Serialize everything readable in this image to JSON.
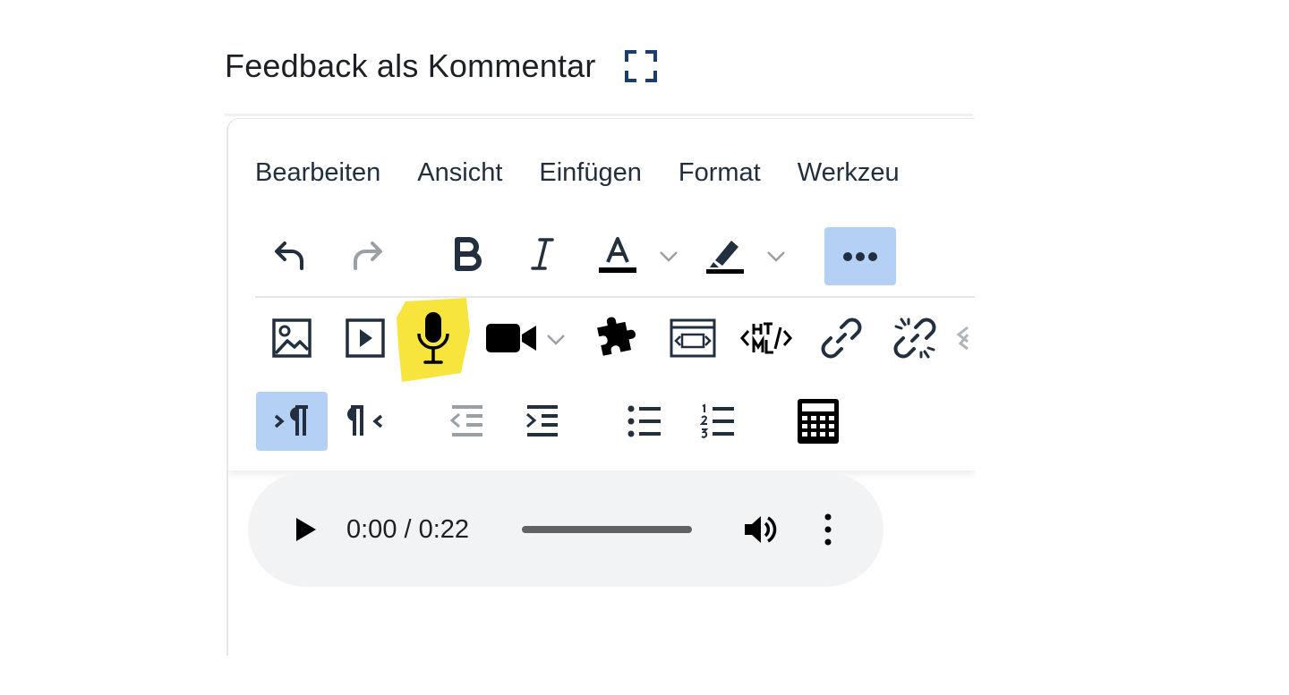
{
  "heading": {
    "title": "Feedback als Kommentar"
  },
  "menubar": {
    "items": [
      "Bearbeiten",
      "Ansicht",
      "Einfügen",
      "Format",
      "Werkzeu"
    ]
  },
  "toolbar": {
    "row1": [
      "undo-icon",
      "redo-icon",
      "bold-icon",
      "italic-icon",
      "text-color-icon",
      "highlight-icon",
      "more-icon"
    ],
    "row2": [
      "image-icon",
      "media-icon",
      "microphone-icon",
      "video-camera-icon",
      "plugin-icon",
      "embed-icon",
      "html-icon",
      "link-icon",
      "unlink-icon"
    ],
    "row3": [
      "ltr-icon",
      "rtl-icon",
      "outdent-icon",
      "indent-icon",
      "bullet-list-icon",
      "numbered-list-icon",
      "calculator-icon"
    ],
    "highlight_marker_color": "#f7e43c",
    "active_color": "#b4d0f5",
    "text_color_bar": "#000000"
  },
  "audio": {
    "time": "0:00 / 0:22",
    "progress": 0.0
  }
}
